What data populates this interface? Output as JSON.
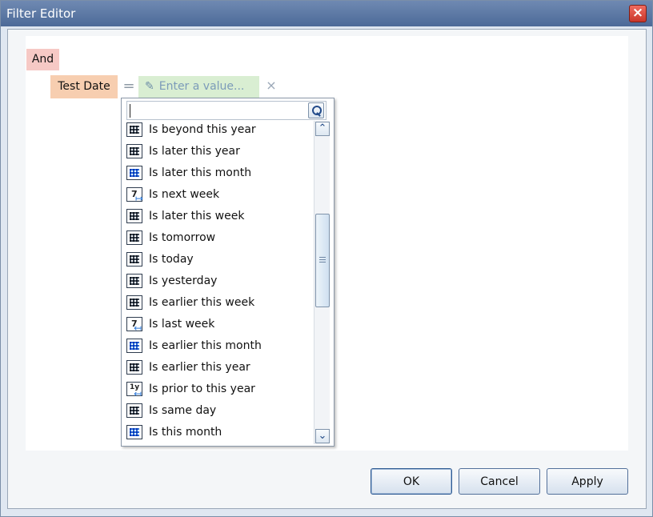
{
  "window": {
    "title": "Filter Editor",
    "close_icon": "close-icon"
  },
  "filter": {
    "group_operator": "And",
    "field": "Test Date",
    "operator": "=",
    "value_placeholder": "Enter a value...",
    "remove_symbol": "×"
  },
  "dropdown": {
    "search_value": "",
    "items": [
      {
        "label": "Is beyond this year",
        "icon": "calendar-grid-icon"
      },
      {
        "label": "Is later this year",
        "icon": "calendar-grid-icon"
      },
      {
        "label": "Is later this month",
        "icon": "calendar-blue-grid-icon"
      },
      {
        "label": "Is next week",
        "icon": "calendar-next-week-icon"
      },
      {
        "label": "Is later this week",
        "icon": "calendar-grid-icon"
      },
      {
        "label": "Is tomorrow",
        "icon": "calendar-grid-icon"
      },
      {
        "label": "Is today",
        "icon": "calendar-grid-icon"
      },
      {
        "label": "Is yesterday",
        "icon": "calendar-grid-icon"
      },
      {
        "label": "Is earlier this week",
        "icon": "calendar-grid-icon"
      },
      {
        "label": "Is last week",
        "icon": "calendar-last-week-icon"
      },
      {
        "label": "Is earlier this month",
        "icon": "calendar-blue-grid-icon"
      },
      {
        "label": "Is earlier this year",
        "icon": "calendar-grid-icon"
      },
      {
        "label": "Is prior to this year",
        "icon": "calendar-prior-year-icon"
      },
      {
        "label": "Is same day",
        "icon": "calendar-grid-icon"
      },
      {
        "label": "Is this month",
        "icon": "calendar-blue-grid-icon"
      }
    ]
  },
  "buttons": {
    "ok": "OK",
    "cancel": "Cancel",
    "apply": "Apply"
  },
  "colors": {
    "and_chip": "#f6c9c5",
    "field_chip": "#f7ceb0",
    "value_chip": "#d9eed2",
    "title_bar": "#4c6a98"
  }
}
